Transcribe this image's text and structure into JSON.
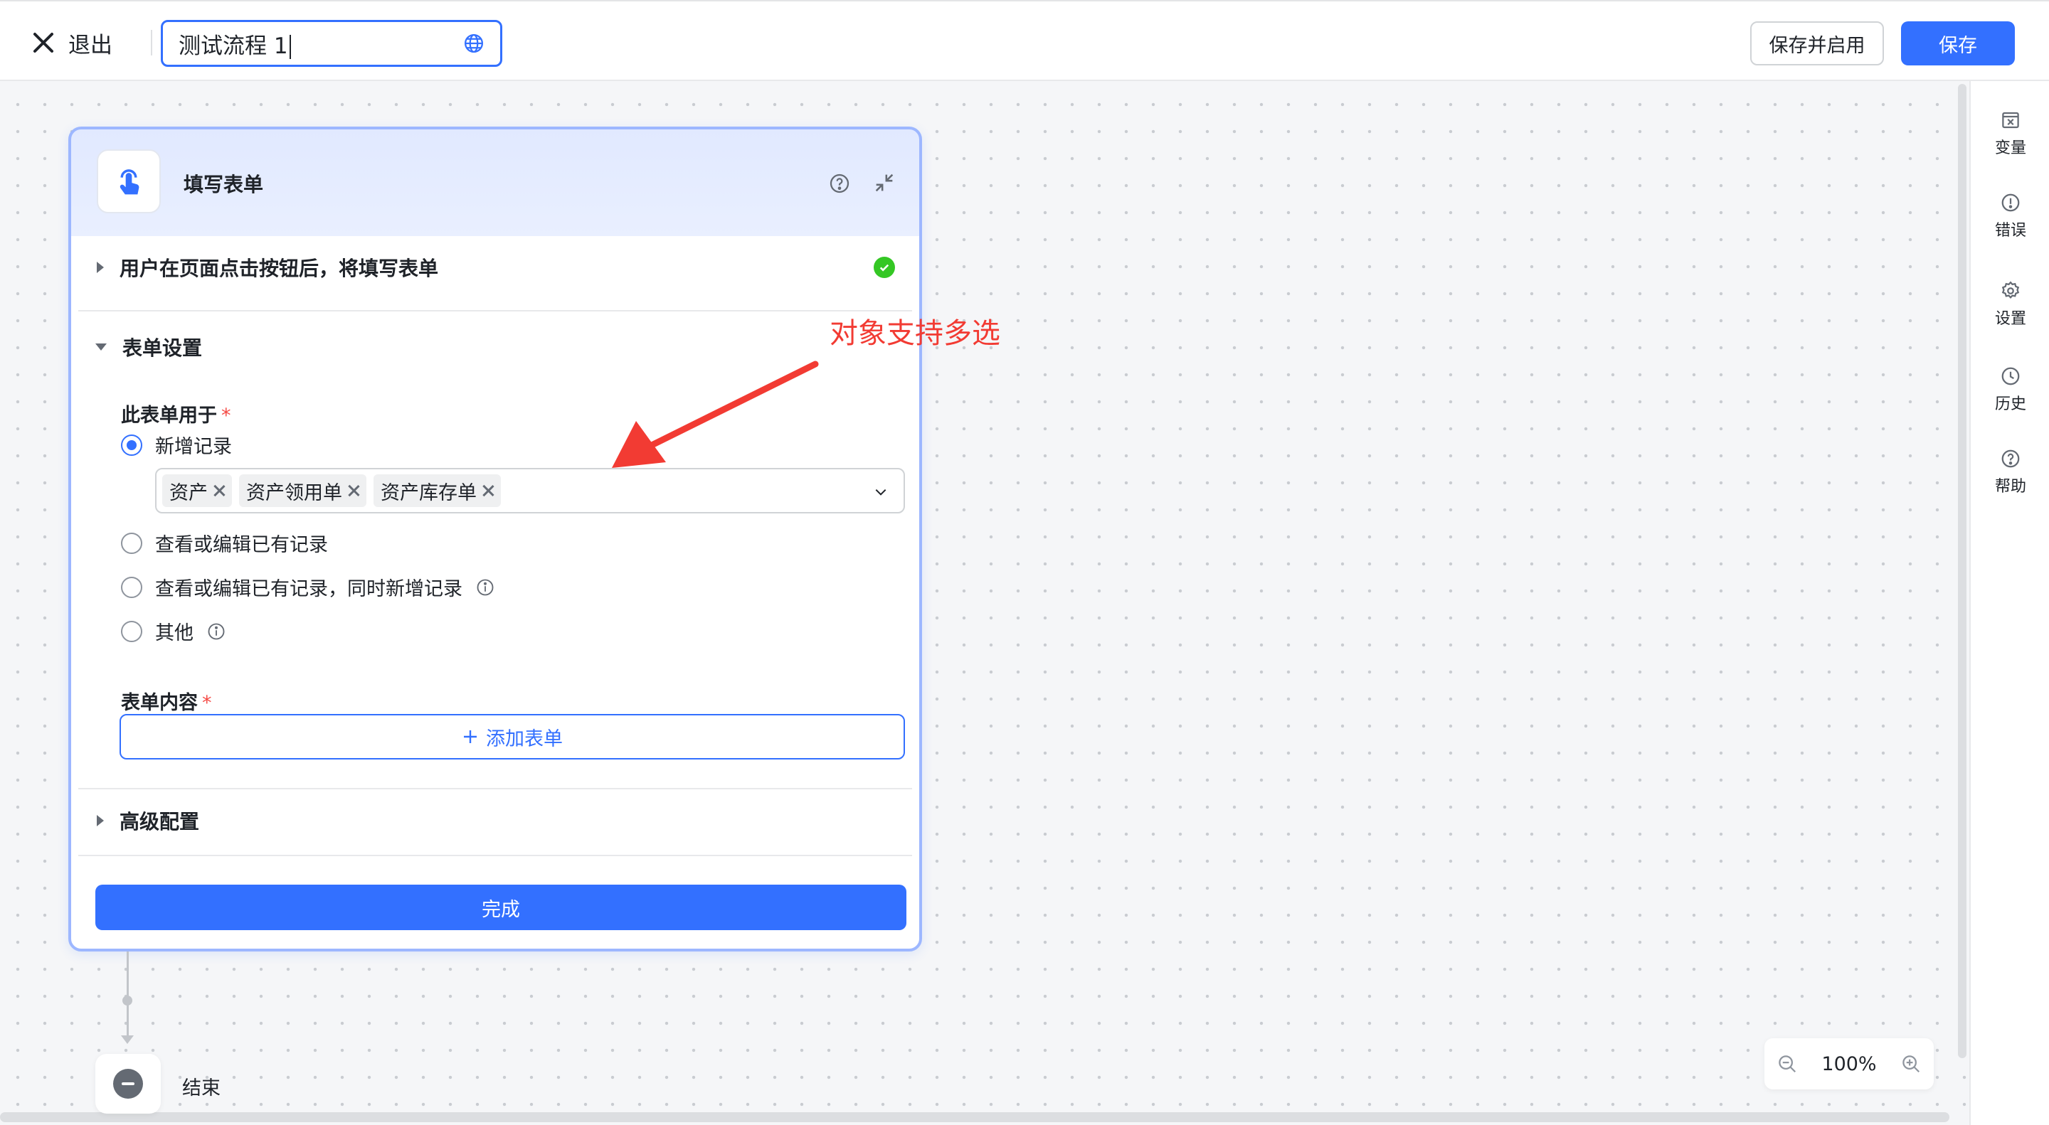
{
  "topbar": {
    "exit_label": "退出",
    "flow_title": "测试流程 1",
    "save_enable_label": "保存并启用",
    "save_label": "保存"
  },
  "rail": {
    "items": [
      {
        "label": "变量",
        "icon": "variable-icon"
      },
      {
        "label": "错误",
        "icon": "error-icon"
      },
      {
        "label": "设置",
        "icon": "gear-icon"
      },
      {
        "label": "历史",
        "icon": "history-icon"
      },
      {
        "label": "帮助",
        "icon": "help-icon"
      }
    ]
  },
  "node": {
    "title": "填写表单",
    "trigger_row": "用户在页面点击按钮后，将填写表单",
    "section_form_settings": "表单设置",
    "form_used_for_label": "此表单用于",
    "required_mark": "*",
    "options": [
      {
        "label": "新增记录",
        "selected": true
      },
      {
        "label": "查看或编辑已有记录",
        "selected": false
      },
      {
        "label": "查看或编辑已有记录，同时新增记录",
        "selected": false
      },
      {
        "label": "其他",
        "selected": false
      }
    ],
    "selected_tags": [
      "资产",
      "资产领用单",
      "资产库存单"
    ],
    "form_content_label": "表单内容",
    "add_form_label": "添加表单",
    "advanced_label": "高级配置",
    "done_label": "完成"
  },
  "annotation": {
    "text": "对象支持多选",
    "color": "#f23b33"
  },
  "end_node": {
    "label": "结束"
  },
  "zoom": {
    "level": "100%"
  },
  "colors": {
    "accent": "#3370ff",
    "success": "#34c724",
    "required": "#f54a45"
  }
}
